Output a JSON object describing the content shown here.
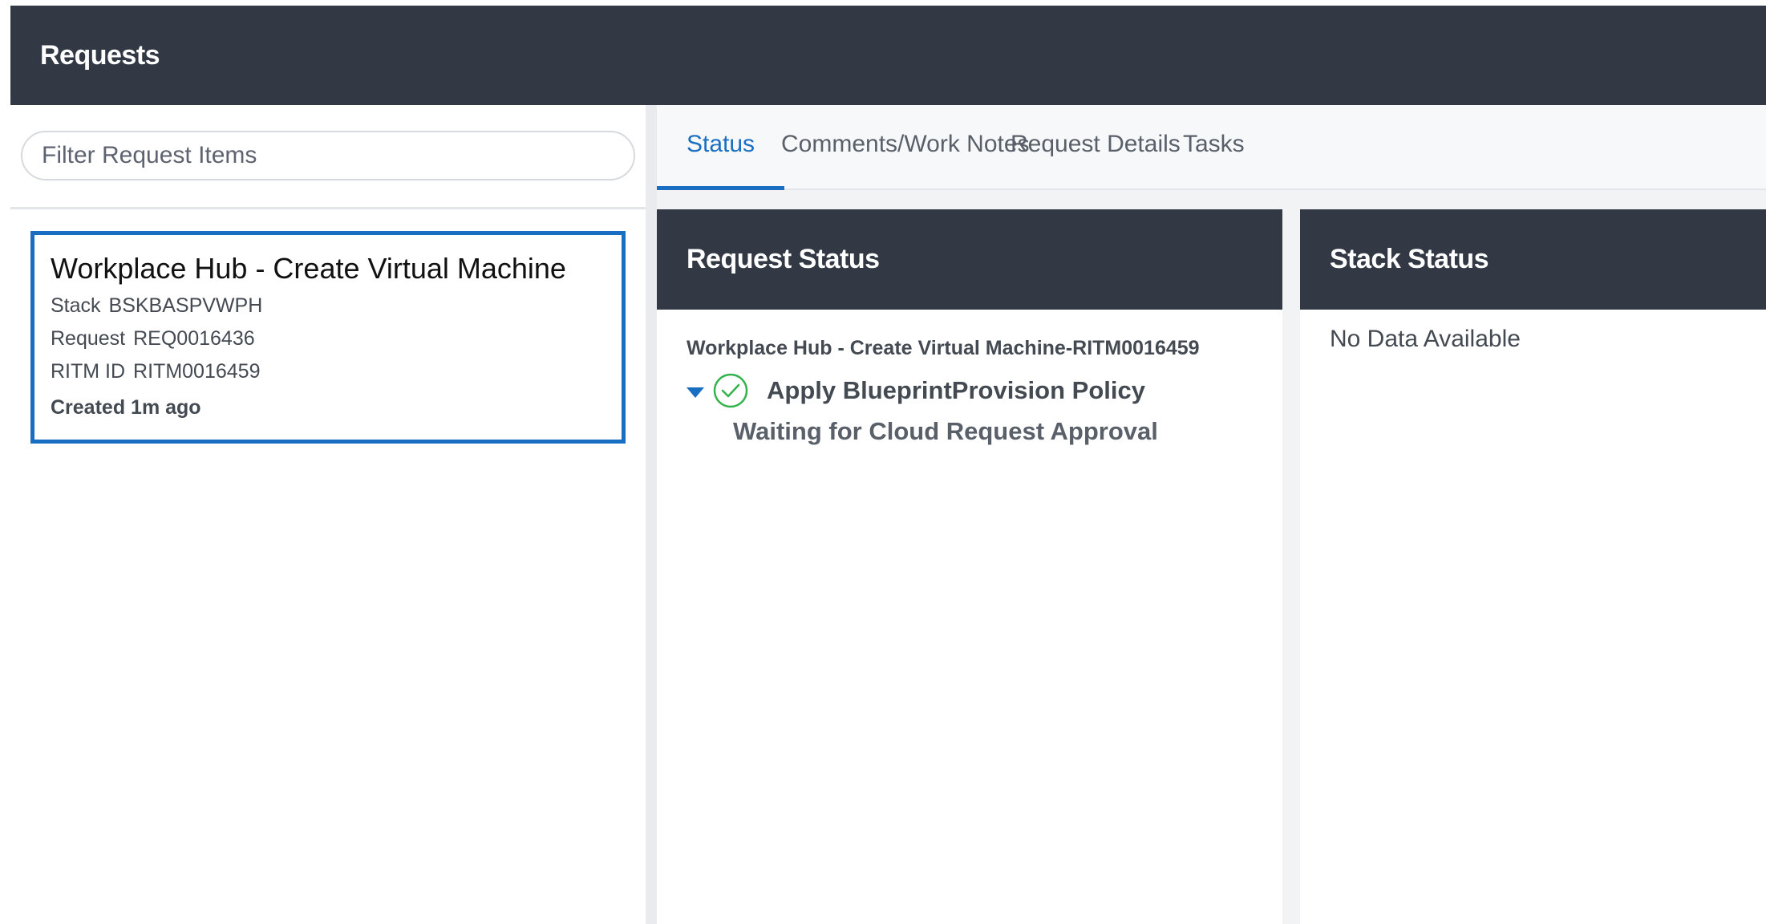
{
  "header": {
    "title": "Requests"
  },
  "sidebar": {
    "filter_placeholder": "Filter Request Items",
    "selected_item": {
      "title": "Workplace Hub - Create Virtual Machine",
      "stack_label": "Stack",
      "stack_value": "BSKBASPVWPH",
      "request_label": "Request",
      "request_value": "REQ0016436",
      "ritm_label": "RITM ID",
      "ritm_value": "RITM0016459",
      "created": "Created 1m ago"
    }
  },
  "tabs": [
    {
      "label": "Status",
      "active": true
    },
    {
      "label": "Comments/Work Notes",
      "active": false
    },
    {
      "label": "Request Details",
      "active": false
    },
    {
      "label": "Tasks",
      "active": false
    }
  ],
  "request_status": {
    "title": "Request Status",
    "item_line": "Workplace Hub - Create Virtual Machine-RITM0016459",
    "policy": "Apply BlueprintProvision Policy",
    "policy_icon": "check-circle-icon",
    "waiting": "Waiting for Cloud Request Approval"
  },
  "stack_status": {
    "title": "Stack Status",
    "empty_text": "No Data Available"
  },
  "colors": {
    "header_bg": "#323945",
    "accent": "#1a6ec2",
    "success": "#34b24c"
  }
}
